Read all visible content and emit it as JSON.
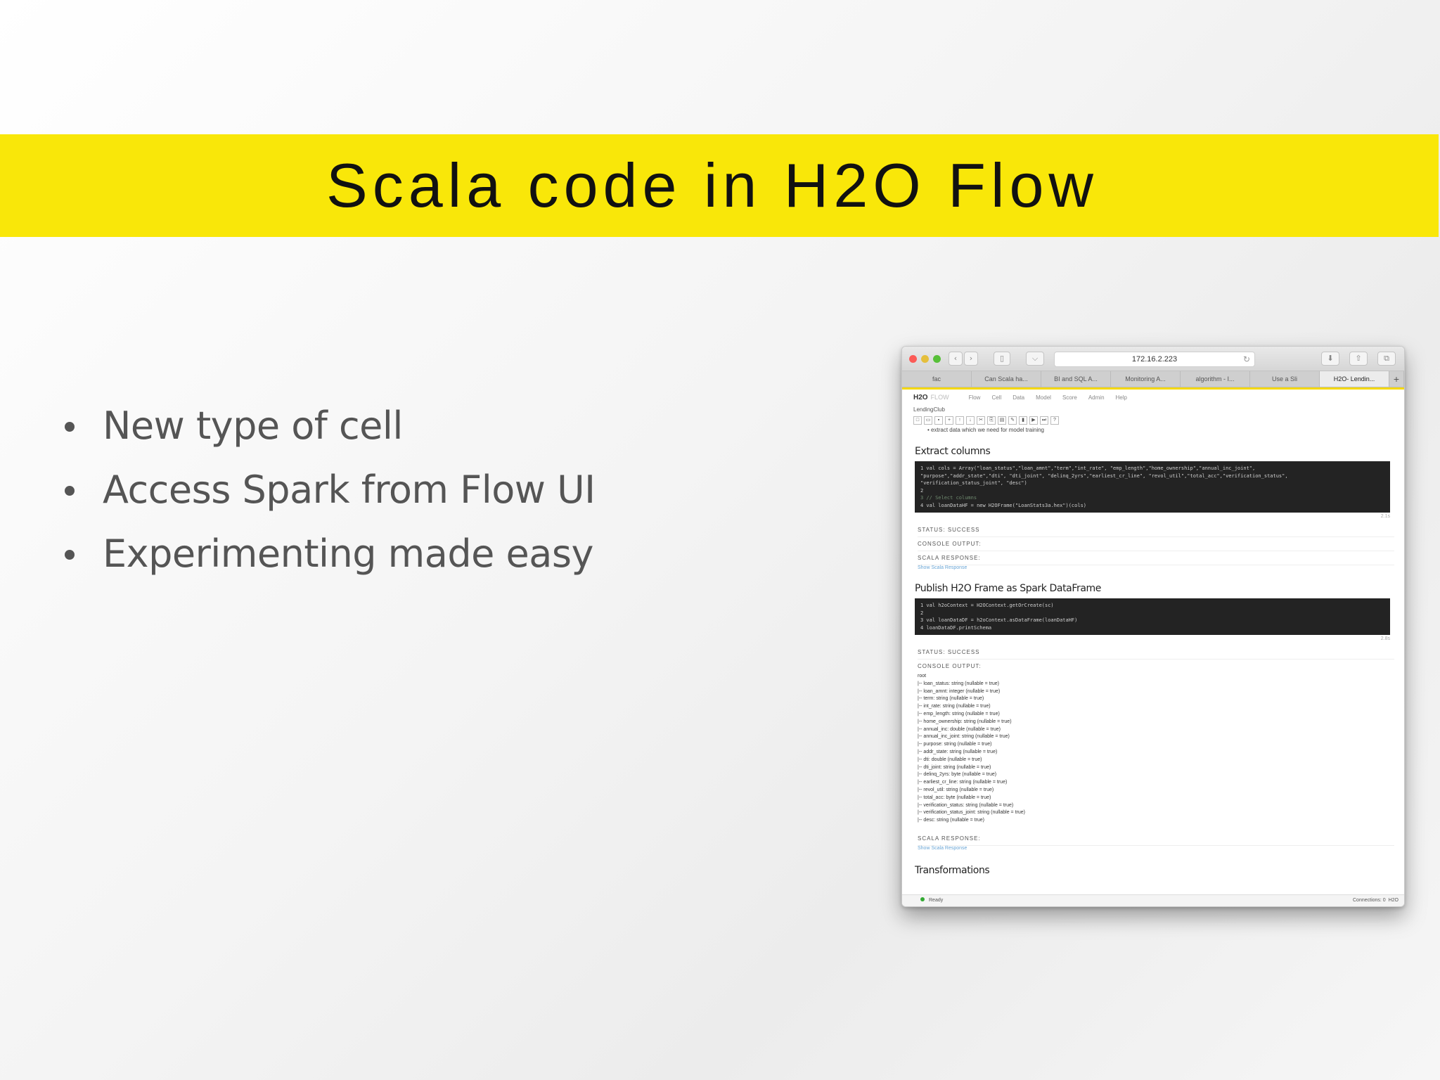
{
  "slide": {
    "title": "Scala code in H2O Flow",
    "bullets": [
      "New type of cell",
      "Access Spark from Flow UI",
      "Experimenting made easy"
    ]
  },
  "browser": {
    "url": "172.16.2.223",
    "tabs": [
      "fac",
      "Can Scala ha...",
      "BI and SQL A...",
      "Monitoring A...",
      "algorithm - I...",
      "Use a Sli",
      "H2O- Lendin..."
    ],
    "new_tab": "+",
    "flow": {
      "logo": "H2O",
      "logo_sub": "FLOW",
      "menu": [
        "Flow",
        "Cell",
        "Data",
        "Model",
        "Score",
        "Admin",
        "Help"
      ],
      "notebook_name": "LendingClub",
      "intro_bullet": "extract data which we need for model training",
      "sections": [
        {
          "heading": "Extract columns",
          "code": [
            "1 val cols = Array(\"loan_status\",\"loan_amnt\",\"term\",\"int_rate\", \"emp_length\",\"home_ownership\",\"annual_inc_joint\",",
            "  \"purpose\",\"addr_state\",\"dti\", \"dti_joint\", \"delinq_2yrs\",\"earliest_cr_line\", \"revol_util\",\"total_acc\",\"verification_status\",",
            "  \"verification_status_joint\", \"desc\")",
            "2",
            "3 // Select columns",
            "4 val loanDataHF = new H2OFrame(\"LoanStats3a.hex\")(cols)"
          ],
          "timing": "2.1s",
          "status": "STATUS: SUCCESS",
          "console_label": "CONSOLE OUTPUT:",
          "console": [],
          "scala_label": "SCALA RESPONSE:",
          "show_link": "Show Scala Response"
        },
        {
          "heading": "Publish H2O Frame as Spark DataFrame",
          "code": [
            "1 val h2oContext = H2OContext.getOrCreate(sc)",
            "2",
            "3 val loanDataDF = h2oContext.asDataFrame(loanDataHF)",
            "4 loanDataDF.printSchema"
          ],
          "timing": "2.8s",
          "status": "STATUS: SUCCESS",
          "console_label": "CONSOLE OUTPUT:",
          "console": [
            "root",
            " |-- loan_status: string (nullable = true)",
            " |-- loan_amnt: integer (nullable = true)",
            " |-- term: string (nullable = true)",
            " |-- int_rate: string (nullable = true)",
            " |-- emp_length: string (nullable = true)",
            " |-- home_ownership: string (nullable = true)",
            " |-- annual_inc: double (nullable = true)",
            " |-- annual_inc_joint: string (nullable = true)",
            " |-- purpose: string (nullable = true)",
            " |-- addr_state: string (nullable = true)",
            " |-- dti: double (nullable = true)",
            " |-- dti_joint: string (nullable = true)",
            " |-- delinq_2yrs: byte (nullable = true)",
            " |-- earliest_cr_line: string (nullable = true)",
            " |-- revol_util: string (nullable = true)",
            " |-- total_acc: byte (nullable = true)",
            " |-- verification_status: string (nullable = true)",
            " |-- verification_status_joint: string (nullable = true)",
            " |-- desc: string (nullable = true)"
          ],
          "scala_label": "SCALA RESPONSE:",
          "show_link": "Show Scala Response"
        }
      ],
      "next_heading": "Transformations",
      "status_ready": "Ready",
      "connections": "Connections: 0",
      "footer_logo": "H2O"
    }
  }
}
